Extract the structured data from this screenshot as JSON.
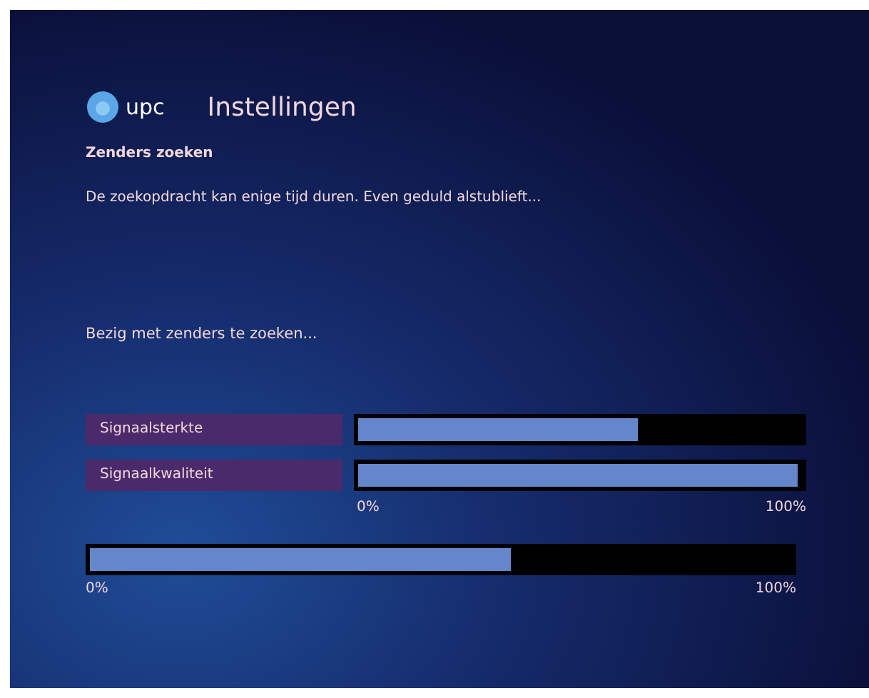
{
  "header": {
    "logo_text": "upc",
    "title": "Instellingen"
  },
  "subtitle": "Zenders zoeken",
  "description": "De zoekopdracht kan enige tijd duren. Even geduld alstublieft...",
  "status": "Bezig met zenders te zoeken...",
  "meters": [
    {
      "name": "Signaalsterkte",
      "level": 0.63
    },
    {
      "name": "Signaalkwaliteit",
      "level": 0.99
    }
  ],
  "meter_scale": {
    "min": "0%",
    "max": "100%"
  },
  "progress": {
    "level": 0.6,
    "min": "0%",
    "max": "100%"
  }
}
